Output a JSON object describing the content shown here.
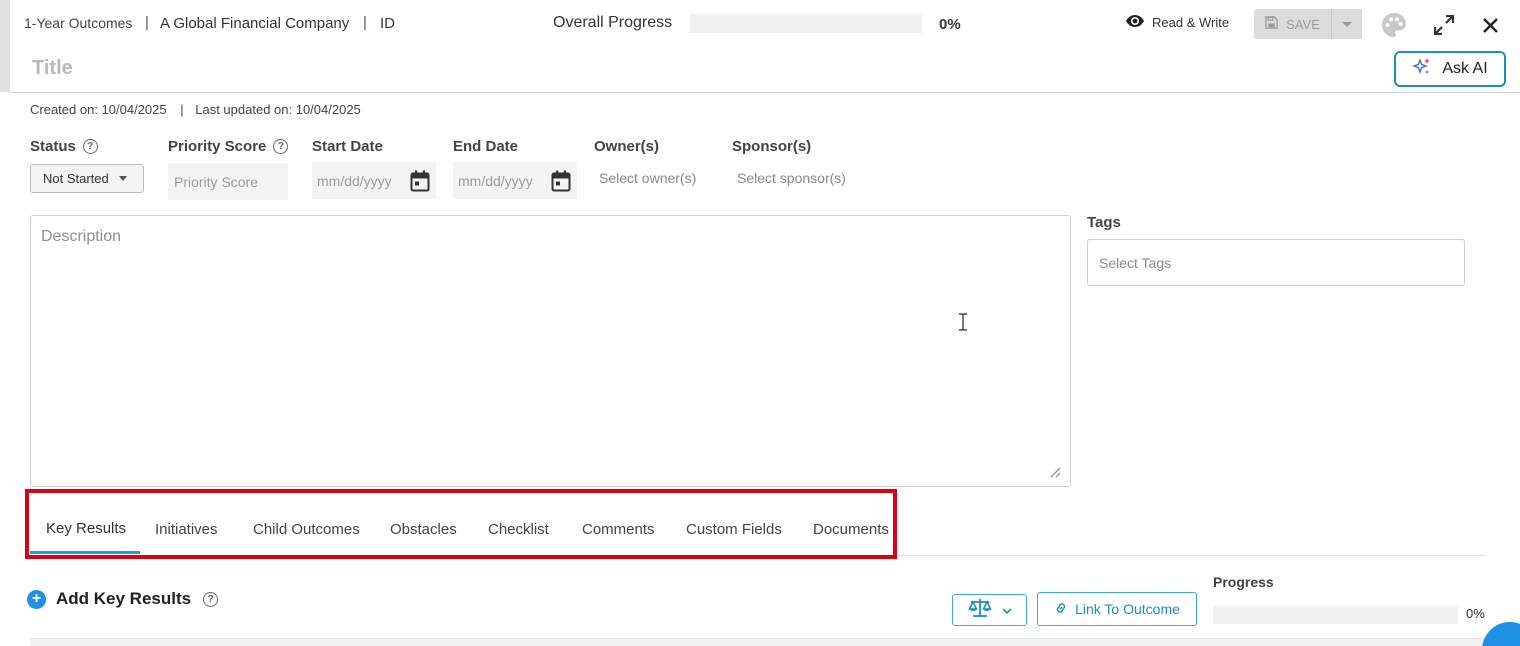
{
  "header": {
    "breadcrumb": [
      "1-Year Outcomes",
      "A Global Financial Company",
      "ID"
    ],
    "separator": "|",
    "overall_progress_label": "Overall Progress",
    "overall_progress_percent": 0,
    "overall_progress_text": "0%",
    "access_mode": "Read & Write",
    "save_label": "SAVE",
    "title_placeholder": "Title",
    "ask_ai_label": "Ask AI"
  },
  "meta": {
    "created": "Created on: 10/04/2025",
    "separator": "|",
    "updated": "Last updated on: 10/04/2025"
  },
  "fields": {
    "status": {
      "label": "Status",
      "value": "Not Started"
    },
    "priority": {
      "label": "Priority Score",
      "placeholder": "Priority Score"
    },
    "start_date": {
      "label": "Start Date",
      "placeholder": "mm/dd/yyyy"
    },
    "end_date": {
      "label": "End Date",
      "placeholder": "mm/dd/yyyy"
    },
    "owners": {
      "label": "Owner(s)",
      "placeholder": "Select owner(s)"
    },
    "sponsors": {
      "label": "Sponsor(s)",
      "placeholder": "Select sponsor(s)"
    },
    "description": {
      "placeholder": "Description"
    },
    "tags": {
      "label": "Tags",
      "placeholder": "Select Tags"
    }
  },
  "tabs": [
    {
      "label": "Key Results",
      "active": true
    },
    {
      "label": "Initiatives",
      "active": false
    },
    {
      "label": "Child Outcomes",
      "active": false
    },
    {
      "label": "Obstacles",
      "active": false
    },
    {
      "label": "Checklist",
      "active": false
    },
    {
      "label": "Comments",
      "active": false
    },
    {
      "label": "Custom Fields",
      "active": false
    },
    {
      "label": "Documents",
      "active": false
    }
  ],
  "key_results": {
    "add_label": "Add Key Results",
    "link_label": "Link To Outcome",
    "progress_label": "Progress",
    "progress_percent": 0,
    "progress_text": "0%"
  },
  "colors": {
    "accent": "#2196f3",
    "ask_ai_border": "#1b8fbf",
    "highlight": "#d9000f"
  },
  "icons": [
    "eye-icon",
    "save-icon",
    "chevron-down-icon",
    "palette-icon",
    "expand-icon",
    "close-icon",
    "sparkle-icon",
    "help-icon",
    "calendar-icon",
    "plus-icon",
    "scale-icon",
    "link-icon"
  ]
}
